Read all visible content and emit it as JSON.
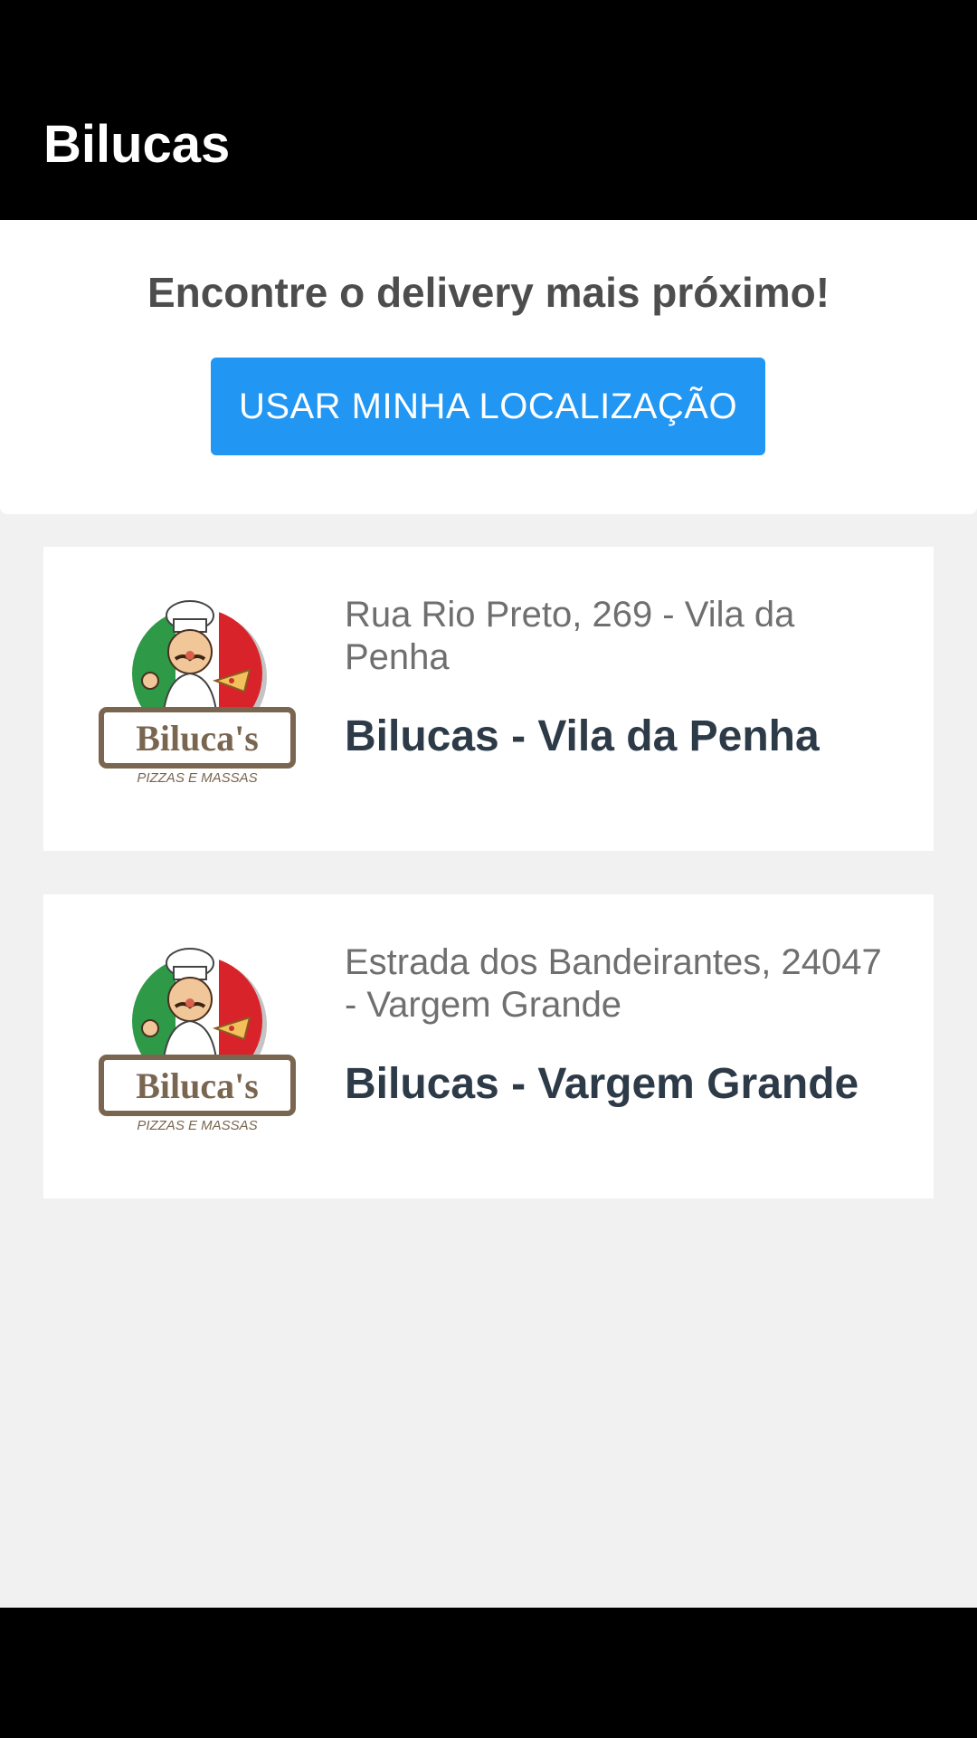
{
  "app_bar": {
    "title": "Bilucas"
  },
  "locate": {
    "headline": "Encontre o delivery mais próximo!",
    "button_label": "USAR MINHA LOCALIZAÇÃO"
  },
  "stores": [
    {
      "address": "Rua Rio Preto, 269 - Vila da Penha",
      "name": "Bilucas - Vila da Penha",
      "logo": {
        "brand": "Biluca's",
        "tagline": "PIZZAS E MASSAS"
      }
    },
    {
      "address": "Estrada dos Bandeirantes, 24047 - Vargem Grande",
      "name": "Bilucas - Vargem Grande",
      "logo": {
        "brand": "Biluca's",
        "tagline": "PIZZAS E MASSAS"
      }
    }
  ],
  "colors": {
    "app_bar": "#000000",
    "accent": "#2196f3",
    "background": "#f1f1f1",
    "store_name": "#2d3a47",
    "address": "#6f6f6f"
  }
}
